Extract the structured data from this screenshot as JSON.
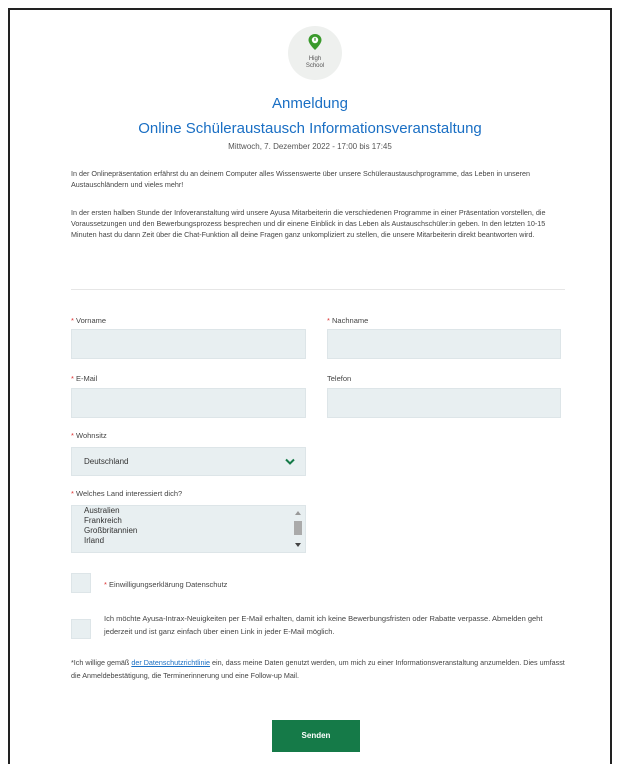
{
  "logo": {
    "line1": "High",
    "line2": "School"
  },
  "header": {
    "title": "Anmeldung",
    "subtitle": "Online Schüleraustausch Informationsveranstaltung",
    "date": "Mittwoch, 7. Dezember 2022 - 17:00 bis 17:45"
  },
  "intro": {
    "p1": "In der Onlinepräsentation erfährst du an deinem Computer alles Wissenswerte über unsere Schüleraustauschprogramme, das Leben in unseren Austauschländern und vieles mehr!",
    "p2": "In der ersten halben Stunde der Infoveranstaltung wird unsere Ayusa Mitarbeiterin die verschiedenen Programme in einer Präsentation vorstellen, die Voraussetzungen und den Bewerbungsprozess besprechen und dir einene Einblick in das Leben als Austauschschüler:in geben. In den letzten 10-15 Minuten hast du dann Zeit über die Chat-Funktion all deine Fragen ganz unkompliziert zu stellen, die unsere Mitarbeiterin direkt beantworten wird."
  },
  "form": {
    "required_mark": "*",
    "vorname_label": "Vorname",
    "nachname_label": "Nachname",
    "email_label": "E-Mail",
    "telefon_label": "Telefon",
    "wohnsitz_label": "Wohnsitz",
    "wohnsitz_value": "Deutschland",
    "land_label": "Welches Land interessiert dich?",
    "land_options": [
      "Australien",
      "Frankreich",
      "Großbritannien",
      "Irland"
    ],
    "consent_label": "Einwilligungserklärung Datenschutz",
    "newsletter_label": "Ich möchte Ayusa-Intrax-Neuigkeiten per E-Mail erhalten, damit ich keine Bewerbungsfristen oder Rabatte verpasse. Abmelden geht jederzeit und ist ganz einfach über einen Link in jeder E-Mail möglich.",
    "note_prefix": "*Ich willige gemäß",
    "note_link": "der Datenschutzrichtlinie",
    "note_suffix": "ein, dass meine Daten genutzt werden, um mich zu einer Informationsveranstaltung anzumelden. Dies umfasst die Anmeldebestätigung, die Terminerinnerung und eine Follow-up Mail.",
    "submit_label": "Senden"
  },
  "colors": {
    "accent": "#1a6fc4",
    "button": "#157a48",
    "required": "#d33",
    "field_bg": "#e8eff1"
  },
  "icons": {
    "logo": "map-pin-icon",
    "select": "chevron-down-icon"
  }
}
